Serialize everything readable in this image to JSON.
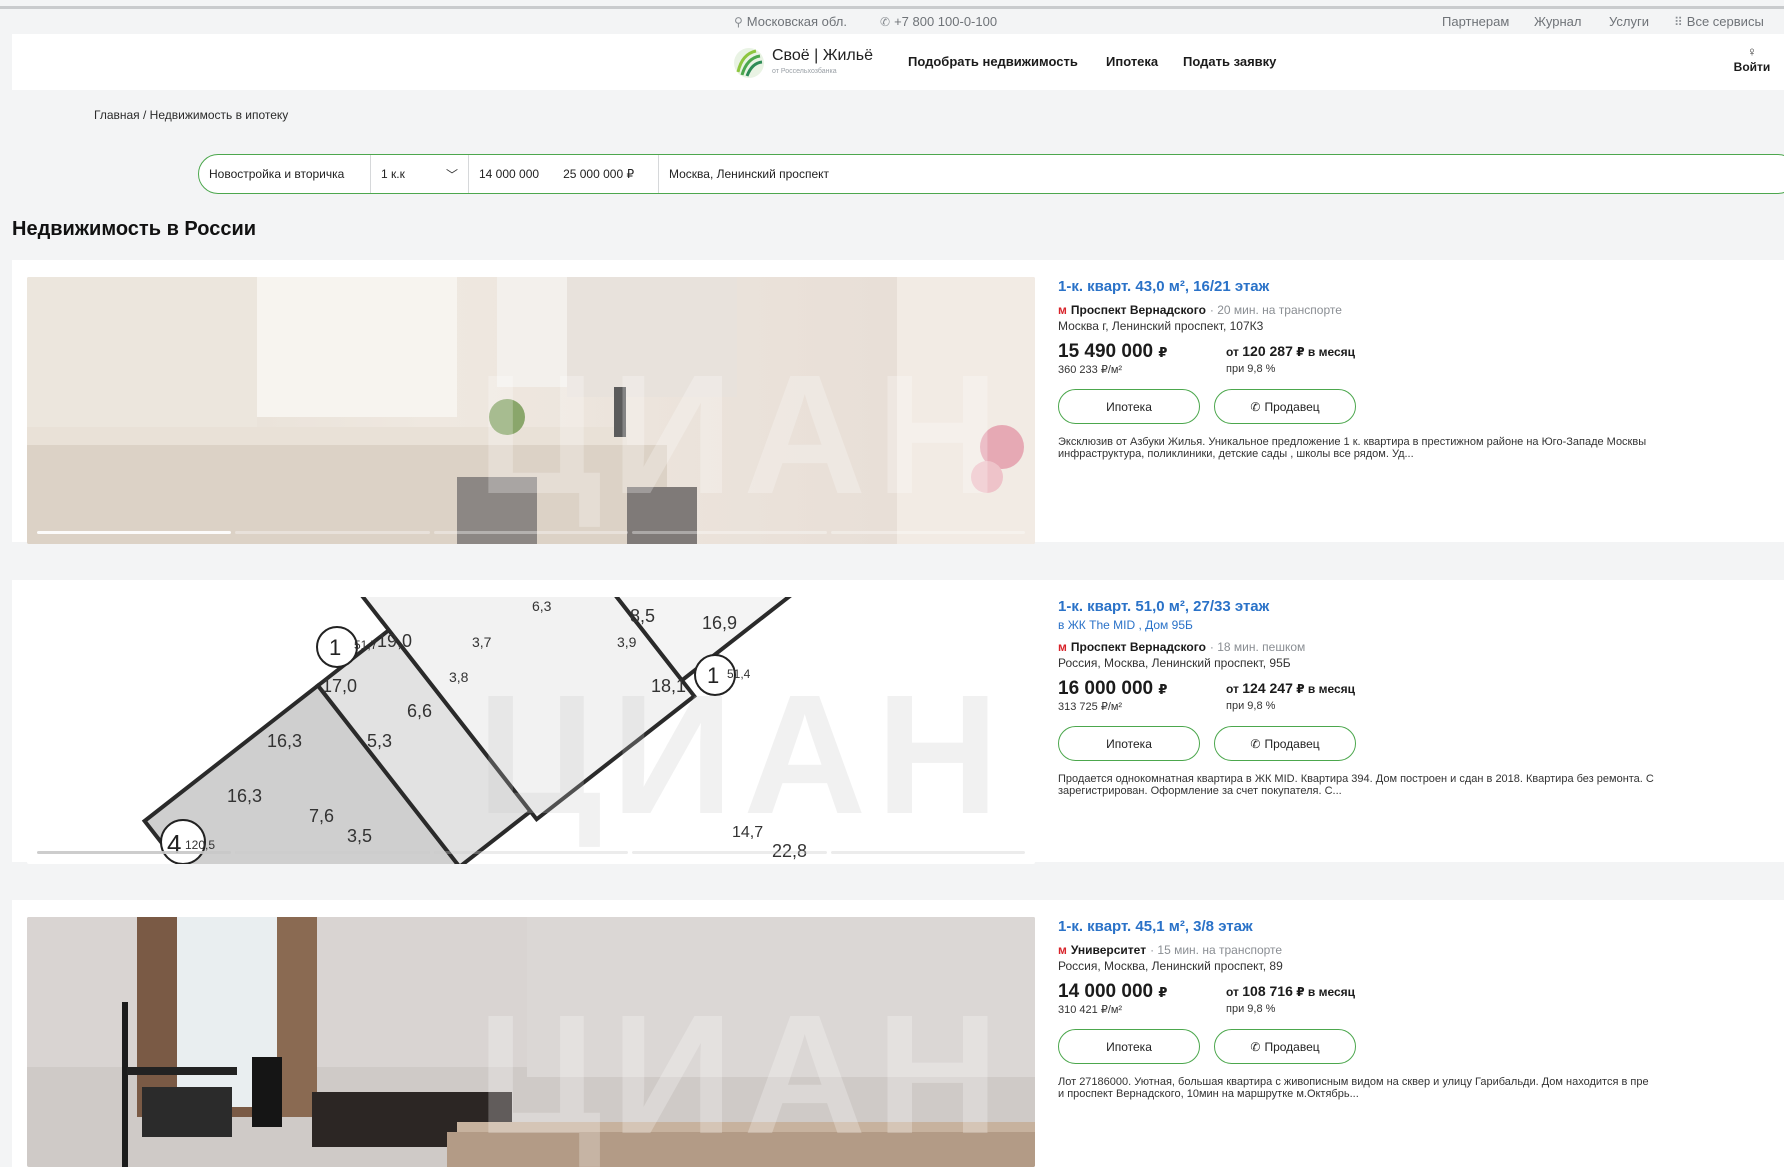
{
  "topbar": {
    "region": "Московская обл.",
    "phone": "+7 800 100-0-100",
    "links": [
      "Партнерам",
      "Журнал",
      "Услуги"
    ],
    "all_services": "Все сервисы"
  },
  "header": {
    "logo_title": "Своё | Жильё",
    "logo_sub": "от Россельхозбанка",
    "nav": [
      "Подобрать недвижимость",
      "Ипотека",
      "Подать заявку"
    ],
    "login": "Войти"
  },
  "breadcrumb": "Главная / Недвижимость в ипотеку",
  "search": {
    "type": "Новостройка и вторичка",
    "rooms": "1 к.к",
    "price_from": "14 000 000",
    "price_to": "25 000 000",
    "currency": "₽",
    "address": "Москва, Ленинский проспект"
  },
  "page_title": "Недвижимость в России",
  "listings": [
    {
      "title": "1-к. кварт. 43,0 м², 16/21 этаж",
      "complex": "",
      "metro_icon": "м",
      "metro": "Проспект Вернадского",
      "transit": "· 20 мин. на транспорте",
      "address": "Москва г, Ленинский проспект, 107К3",
      "price": "15 490 000",
      "currency": "₽",
      "per_m2": "360 233 ₽/м²",
      "mortgage_from": "от",
      "mortgage_amount": "120 287",
      "mortgage_suffix": "₽ в месяц",
      "rate": "при 9,8 %",
      "btn_mortgage": "Ипотека",
      "btn_seller": "Продавец",
      "desc1": "Эксклюзив от Азбуки Жилья. Уникальное предложение 1 к. квартира в престижном районе на Юго-Западе Москвы",
      "desc2": "инфраструктура, поликлиники, детские сады , школы все рядом. Уд..."
    },
    {
      "title": "1-к. кварт. 51,0 м², 27/33 этаж",
      "complex": "в ЖК The MID , Дом 95Б",
      "metro_icon": "м",
      "metro": "Проспект Вернадского",
      "transit": "· 18 мин. пешком",
      "address": "Россия, Москва, Ленинский проспект, 95Б",
      "price": "16 000 000",
      "currency": "₽",
      "per_m2": "313 725 ₽/м²",
      "mortgage_from": "от",
      "mortgage_amount": "124 247",
      "mortgage_suffix": "₽ в месяц",
      "rate": "при 9,8 %",
      "btn_mortgage": "Ипотека",
      "btn_seller": "Продавец",
      "desc1": "Продается однокомнатная квартира в ЖК MID. Квартира 394. Дом построен и сдан в 2018. Квартира без ремонта. С",
      "desc2": "зарегистрирован. Оформление за счет покупателя. С..."
    },
    {
      "title": "1-к. кварт. 45,1 м², 3/8 этаж",
      "complex": "",
      "metro_icon": "м",
      "metro": "Университет",
      "transit": "· 15 мин. на транспорте",
      "address": "Россия, Москва, Ленинский проспект, 89",
      "price": "14 000 000",
      "currency": "₽",
      "per_m2": "310 421 ₽/м²",
      "mortgage_from": "от",
      "mortgage_amount": "108 716",
      "mortgage_suffix": "₽ в месяц",
      "rate": "при 9,8 %",
      "btn_mortgage": "Ипотека",
      "btn_seller": "Продавец",
      "desc1": "Лот 27186000. Уютная, большая квартира с живописным видом на сквер и улицу Гарибальди. Дом находится в пре",
      "desc2": "и проспект Вернадского, 10мин на маршрутке м.Октябрь..."
    }
  ],
  "floorplan_labels": [
    "51,7",
    "19,0",
    "17,0",
    "6,6",
    "3,8",
    "3,7",
    "16,3",
    "5,3",
    "16,3",
    "7,6",
    "3,5",
    "120,5",
    "8,5",
    "16,9",
    "3,9",
    "18,1",
    "51,4",
    "14,7",
    "22,8",
    "6,3"
  ],
  "floorplan_room_counts": [
    "1",
    "1",
    "4"
  ],
  "watermark": "ЦИАН",
  "colors": {
    "accent": "#4ca74d",
    "link": "#2a72c8",
    "metro": "#d8232a"
  }
}
